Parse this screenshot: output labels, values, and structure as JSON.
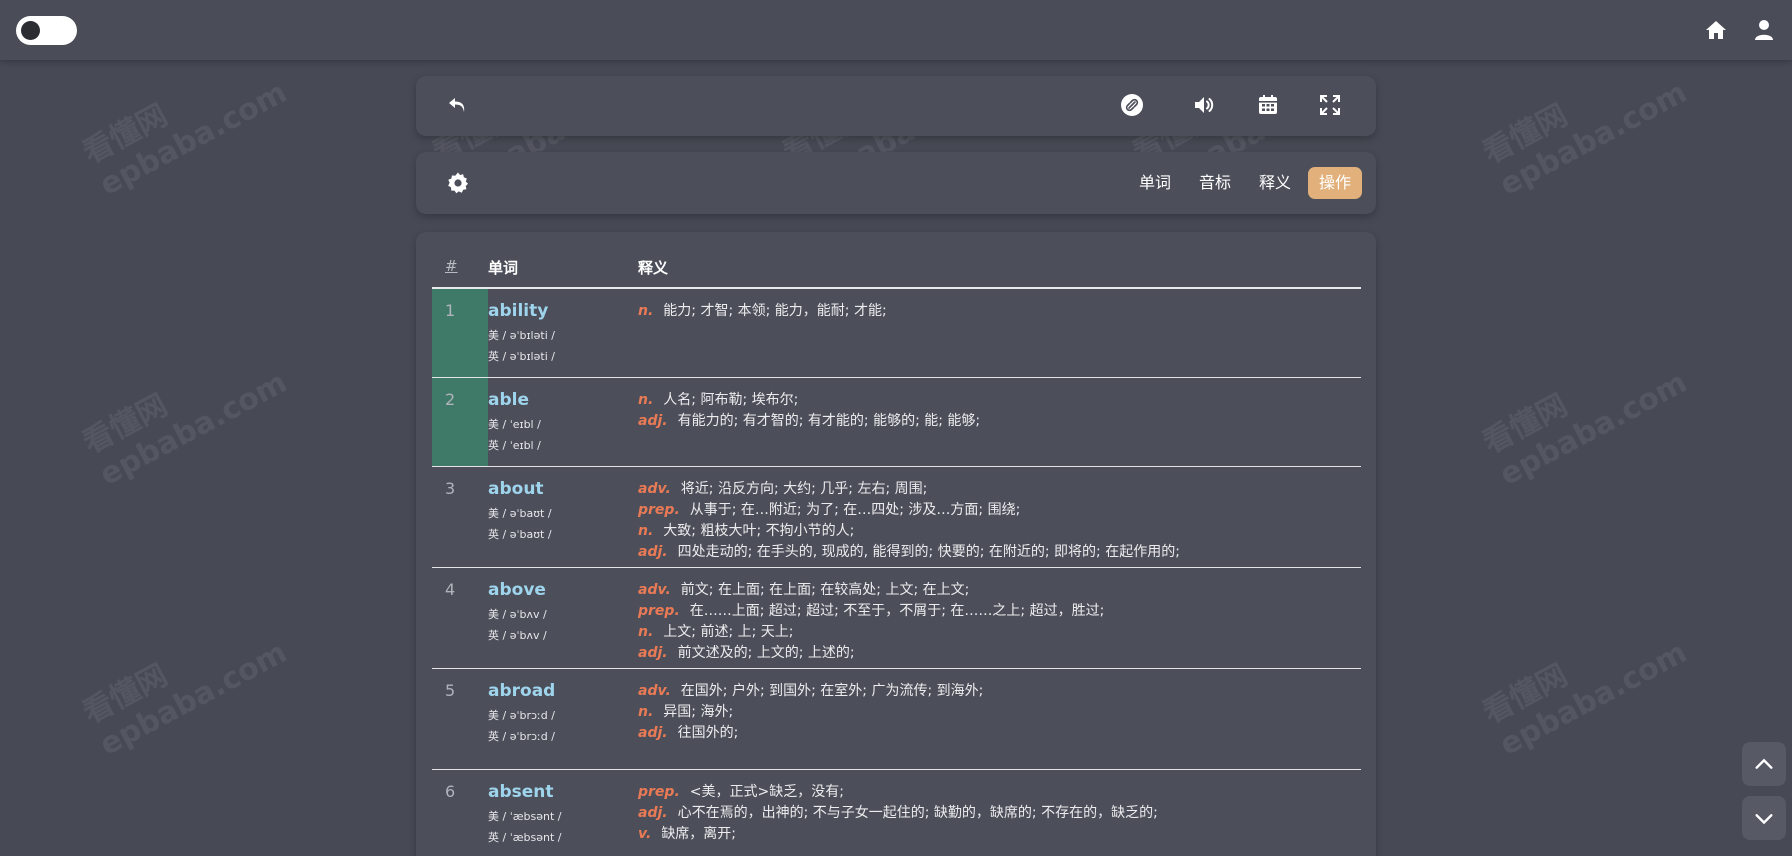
{
  "topbar": {
    "toggle": "theme-toggle",
    "icons": [
      "home-icon",
      "user-icon"
    ]
  },
  "toolbar": {
    "icons": [
      "back-icon",
      "link-icon",
      "volume-icon",
      "calendar-icon",
      "fullscreen-icon"
    ]
  },
  "settings_bar": {
    "icon": "gear-icon",
    "tabs": [
      "单词",
      "音标",
      "释义",
      "操作"
    ],
    "active_tab": "操作",
    "accent_color": "#e2b07a"
  },
  "table": {
    "headers": {
      "num": "#",
      "word": "单词",
      "def": "释义"
    },
    "rows": [
      {
        "num": "1",
        "word": "ability",
        "us": "美 / əˈbɪləti /",
        "uk": "英 / əˈbɪləti /",
        "defs": [
          {
            "pos": "n.",
            "text": "能力; 才智; 本领; 能力，能耐; 才能;"
          }
        ]
      },
      {
        "num": "2",
        "word": "able",
        "us": "美 / ˈeɪbl /",
        "uk": "英 / ˈeɪbl /",
        "defs": [
          {
            "pos": "n.",
            "text": "人名; 阿布勒; 埃布尔;"
          },
          {
            "pos": "adj.",
            "text": "有能力的; 有才智的; 有才能的; 能够的; 能; 能够;"
          }
        ]
      },
      {
        "num": "3",
        "word": "about",
        "us": "美 / əˈbaʊt /",
        "uk": "英 / əˈbaʊt /",
        "defs": [
          {
            "pos": "adv.",
            "text": "将近; 沿反方向; 大约; 几乎; 左右; 周围;"
          },
          {
            "pos": "prep.",
            "text": "从事于; 在…附近; 为了; 在…四处; 涉及…方面; 围绕;"
          },
          {
            "pos": "n.",
            "text": "大致; 粗枝大叶; 不拘小节的人;"
          },
          {
            "pos": "adj.",
            "text": "四处走动的; 在手头的, 现成的, 能得到的; 快要的; 在附近的; 即将的; 在起作用的;"
          }
        ]
      },
      {
        "num": "4",
        "word": "above",
        "us": "美 / əˈbʌv /",
        "uk": "英 / əˈbʌv /",
        "defs": [
          {
            "pos": "adv.",
            "text": "前文; 在上面; 在上面; 在较高处; 上文; 在上文;"
          },
          {
            "pos": "prep.",
            "text": "在……上面; 超过; 超过; 不至于，不屑于; 在……之上; 超过，胜过;"
          },
          {
            "pos": "n.",
            "text": "上文; 前述; 上; 天上;"
          },
          {
            "pos": "adj.",
            "text": "前文述及的; 上文的; 上述的;"
          }
        ]
      },
      {
        "num": "5",
        "word": "abroad",
        "us": "美 / əˈbrɔːd /",
        "uk": "英 / əˈbrɔːd /",
        "defs": [
          {
            "pos": "adv.",
            "text": "在国外; 户外; 到国外; 在室外; 广为流传; 到海外;"
          },
          {
            "pos": "n.",
            "text": "异国; 海外;"
          },
          {
            "pos": "adj.",
            "text": "往国外的;"
          }
        ]
      },
      {
        "num": "6",
        "word": "absent",
        "us": "美 / ˈæbsənt /",
        "uk": "英 / ˈæbsənt /",
        "defs": [
          {
            "pos": "prep.",
            "text": "<美，正式>缺乏，没有;"
          },
          {
            "pos": "adj.",
            "text": "心不在焉的，出神的; 不与子女一起住的; 缺勤的，缺席的; 不存在的，缺乏的;"
          },
          {
            "pos": "v.",
            "text": "缺席，离开;"
          }
        ]
      }
    ]
  },
  "scroll": {
    "icons": [
      "chevron-up-icon",
      "chevron-down-icon"
    ]
  },
  "watermark": {
    "line1": "看懂网",
    "line2": "epbaba.com"
  }
}
